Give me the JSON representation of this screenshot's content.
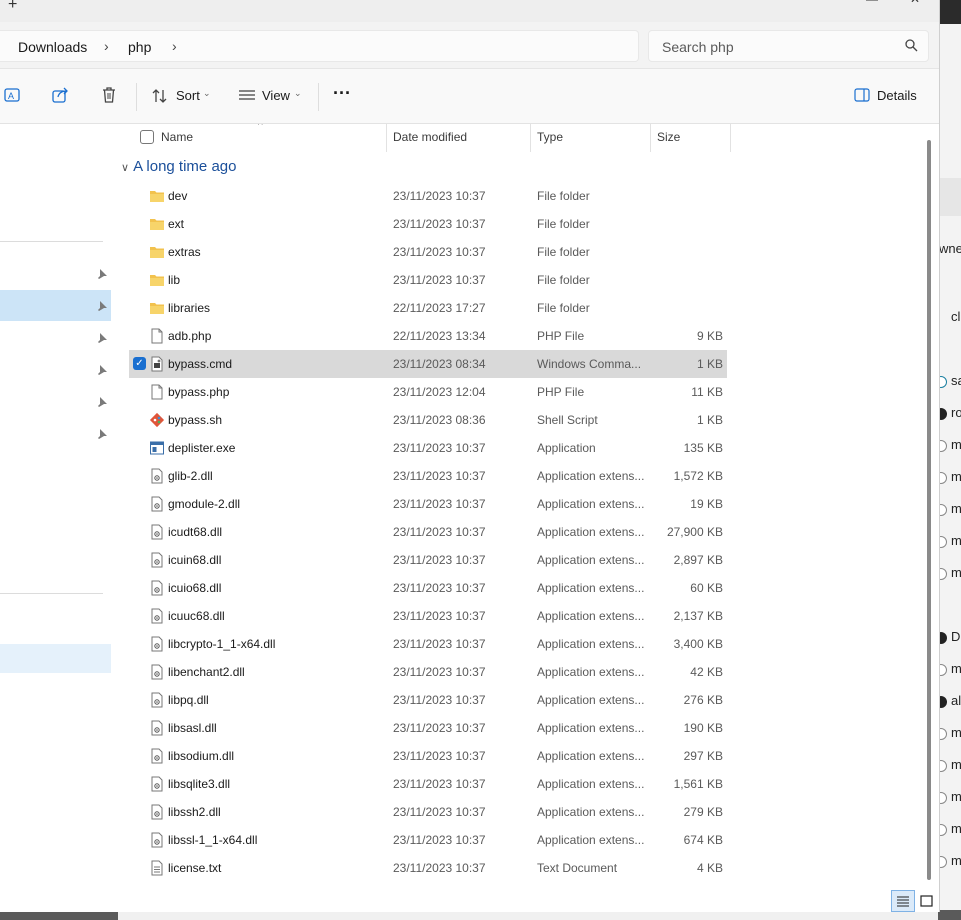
{
  "breadcrumb": {
    "items": [
      "Downloads",
      "php"
    ]
  },
  "search": {
    "placeholder": "Search php"
  },
  "toolbar": {
    "sort_label": "Sort",
    "view_label": "View",
    "more_label": "···",
    "details_label": "Details"
  },
  "columns": {
    "name": "Name",
    "date": "Date modified",
    "type": "Type",
    "size": "Size"
  },
  "group_label": "A long time ago",
  "files": [
    {
      "name": "dev",
      "date": "23/11/2023 10:37",
      "type": "File folder",
      "size": "",
      "icon": "folder-icon",
      "selected": false
    },
    {
      "name": "ext",
      "date": "23/11/2023 10:37",
      "type": "File folder",
      "size": "",
      "icon": "folder-icon",
      "selected": false
    },
    {
      "name": "extras",
      "date": "23/11/2023 10:37",
      "type": "File folder",
      "size": "",
      "icon": "folder-icon",
      "selected": false
    },
    {
      "name": "lib",
      "date": "23/11/2023 10:37",
      "type": "File folder",
      "size": "",
      "icon": "folder-icon",
      "selected": false
    },
    {
      "name": "libraries",
      "date": "22/11/2023 17:27",
      "type": "File folder",
      "size": "",
      "icon": "folder-icon",
      "selected": false
    },
    {
      "name": "adb.php",
      "date": "22/11/2023 13:34",
      "type": "PHP File",
      "size": "9 KB",
      "icon": "file-icon",
      "selected": false
    },
    {
      "name": "bypass.cmd",
      "date": "23/11/2023 08:34",
      "type": "Windows Comma...",
      "size": "1 KB",
      "icon": "cmd-file-icon",
      "selected": true
    },
    {
      "name": "bypass.php",
      "date": "23/11/2023 12:04",
      "type": "PHP File",
      "size": "11 KB",
      "icon": "file-icon",
      "selected": false
    },
    {
      "name": "bypass.sh",
      "date": "23/11/2023 08:36",
      "type": "Shell Script",
      "size": "1 KB",
      "icon": "git-icon",
      "selected": false
    },
    {
      "name": "deplister.exe",
      "date": "23/11/2023 10:37",
      "type": "Application",
      "size": "135 KB",
      "icon": "exe-icon",
      "selected": false
    },
    {
      "name": "glib-2.dll",
      "date": "23/11/2023 10:37",
      "type": "Application extens...",
      "size": "1,572 KB",
      "icon": "dll-icon",
      "selected": false
    },
    {
      "name": "gmodule-2.dll",
      "date": "23/11/2023 10:37",
      "type": "Application extens...",
      "size": "19 KB",
      "icon": "dll-icon",
      "selected": false
    },
    {
      "name": "icudt68.dll",
      "date": "23/11/2023 10:37",
      "type": "Application extens...",
      "size": "27,900 KB",
      "icon": "dll-icon",
      "selected": false
    },
    {
      "name": "icuin68.dll",
      "date": "23/11/2023 10:37",
      "type": "Application extens...",
      "size": "2,897 KB",
      "icon": "dll-icon",
      "selected": false
    },
    {
      "name": "icuio68.dll",
      "date": "23/11/2023 10:37",
      "type": "Application extens...",
      "size": "60 KB",
      "icon": "dll-icon",
      "selected": false
    },
    {
      "name": "icuuc68.dll",
      "date": "23/11/2023 10:37",
      "type": "Application extens...",
      "size": "2,137 KB",
      "icon": "dll-icon",
      "selected": false
    },
    {
      "name": "libcrypto-1_1-x64.dll",
      "date": "23/11/2023 10:37",
      "type": "Application extens...",
      "size": "3,400 KB",
      "icon": "dll-icon",
      "selected": false
    },
    {
      "name": "libenchant2.dll",
      "date": "23/11/2023 10:37",
      "type": "Application extens...",
      "size": "42 KB",
      "icon": "dll-icon",
      "selected": false
    },
    {
      "name": "libpq.dll",
      "date": "23/11/2023 10:37",
      "type": "Application extens...",
      "size": "276 KB",
      "icon": "dll-icon",
      "selected": false
    },
    {
      "name": "libsasl.dll",
      "date": "23/11/2023 10:37",
      "type": "Application extens...",
      "size": "190 KB",
      "icon": "dll-icon",
      "selected": false
    },
    {
      "name": "libsodium.dll",
      "date": "23/11/2023 10:37",
      "type": "Application extens...",
      "size": "297 KB",
      "icon": "dll-icon",
      "selected": false
    },
    {
      "name": "libsqlite3.dll",
      "date": "23/11/2023 10:37",
      "type": "Application extens...",
      "size": "1,561 KB",
      "icon": "dll-icon",
      "selected": false
    },
    {
      "name": "libssh2.dll",
      "date": "23/11/2023 10:37",
      "type": "Application extens...",
      "size": "279 KB",
      "icon": "dll-icon",
      "selected": false
    },
    {
      "name": "libssl-1_1-x64.dll",
      "date": "23/11/2023 10:37",
      "type": "Application extens...",
      "size": "674 KB",
      "icon": "dll-icon",
      "selected": false
    },
    {
      "name": "license.txt",
      "date": "23/11/2023 10:37",
      "type": "Text Document",
      "size": "4 KB",
      "icon": "text-file-icon",
      "selected": false
    }
  ],
  "background_window": {
    "fragments": [
      "wne",
      "cl",
      "sa",
      "ro",
      "m",
      "m",
      "m",
      "m",
      "m",
      "D",
      "m",
      "al",
      "m",
      "m",
      "m",
      "m",
      "m"
    ]
  },
  "colors": {
    "accent": "#1a6fd0",
    "selection": "#cce4f7",
    "group": "#1b4f9a",
    "folder": "#f2c24e"
  }
}
